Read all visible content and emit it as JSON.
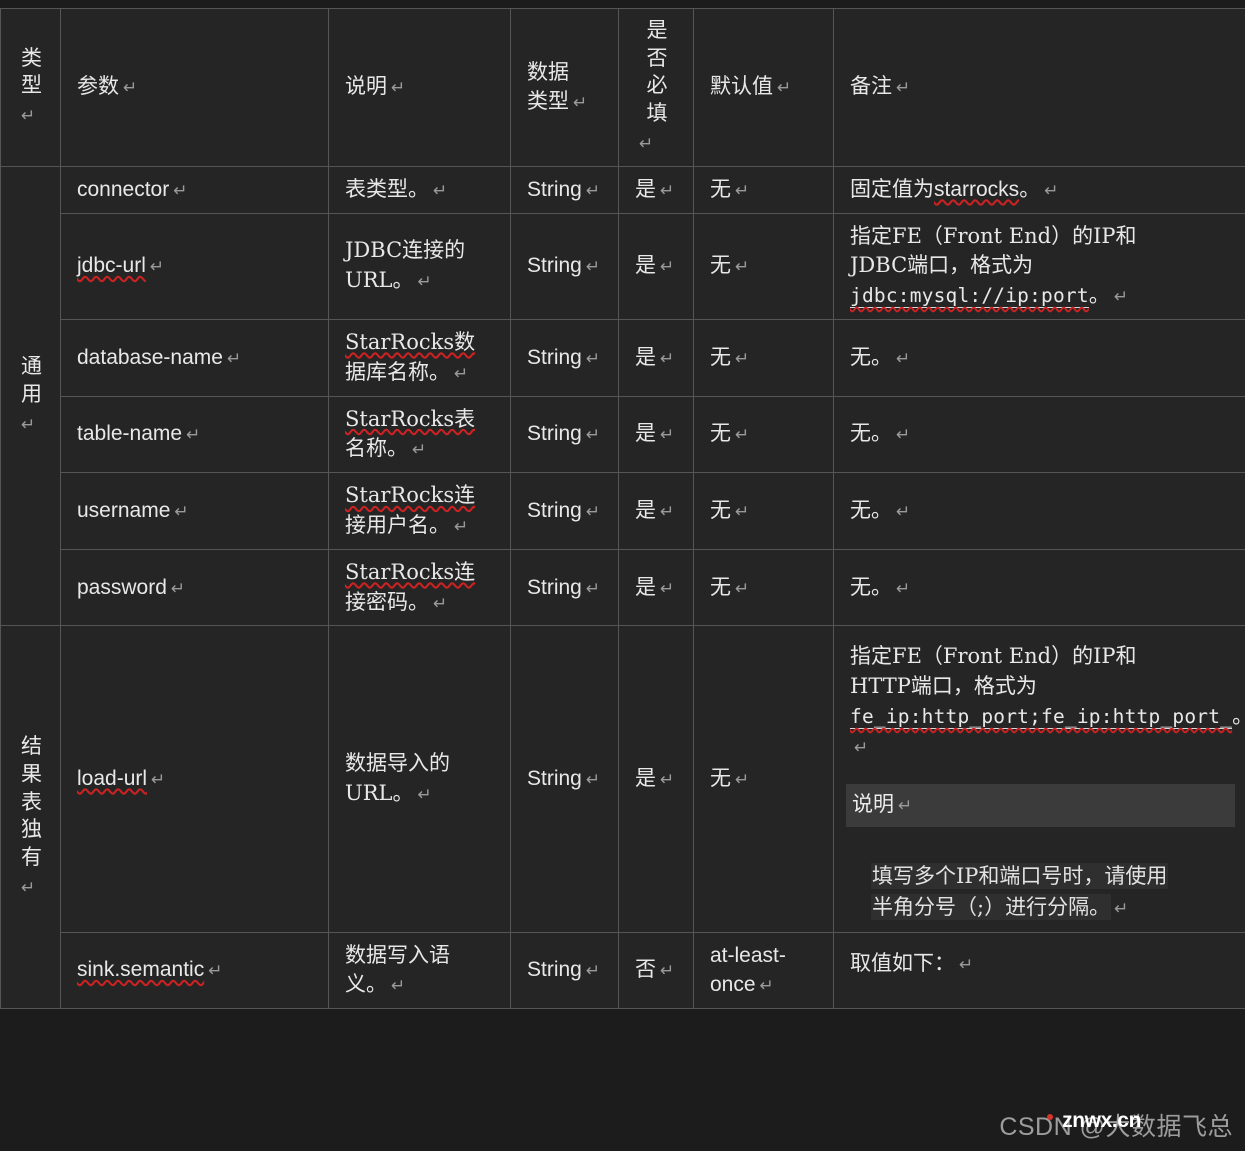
{
  "table": {
    "columns": [
      {
        "key": "type",
        "label": "类型"
      },
      {
        "key": "param",
        "label": "参数"
      },
      {
        "key": "desc",
        "label": "说明"
      },
      {
        "key": "dtype",
        "label": "数据类型"
      },
      {
        "key": "req",
        "label": "是否必填"
      },
      {
        "key": "default",
        "label": "默认值"
      },
      {
        "key": "remark",
        "label": "备注"
      }
    ],
    "groups": [
      {
        "label": "通用",
        "rowspan": 6
      },
      {
        "label": "结果表独有",
        "rowspan": 2
      }
    ],
    "rows": [
      {
        "param": "connector",
        "desc": "表类型。",
        "dtype": "String",
        "req": "是",
        "default": "无",
        "remark_pre": "固定值为",
        "remark_code": "starrocks",
        "remark_post": "。"
      },
      {
        "param": "jdbc-url",
        "desc_line1": "JDBC连接的",
        "desc_line2": "URL。",
        "dtype": "String",
        "req": "是",
        "default": "无",
        "remark_line1": "指定FE（Front End）的IP和",
        "remark_line2": "JDBC端口，格式为",
        "remark_code": "jdbc:mysql://ip:port",
        "remark_tail": "。"
      },
      {
        "param": "database-name",
        "desc_line1": "StarRocks数",
        "desc_line2": "据库名称。",
        "dtype": "String",
        "req": "是",
        "default": "无",
        "remark": "无。"
      },
      {
        "param": "table-name",
        "desc_line1": "StarRocks表",
        "desc_line2": "名称。",
        "dtype": "String",
        "req": "是",
        "default": "无",
        "remark": "无。"
      },
      {
        "param": "username",
        "desc_line1": "StarRocks连",
        "desc_line2": "接用户名。",
        "dtype": "String",
        "req": "是",
        "default": "无",
        "remark": "无。"
      },
      {
        "param": "password",
        "desc_line1": "StarRocks连",
        "desc_line2": "接密码。",
        "dtype": "String",
        "req": "是",
        "default": "无",
        "remark": "无。"
      },
      {
        "param": "load-url",
        "desc_line1": "数据导入的",
        "desc_line2": "URL。",
        "dtype": "String",
        "req": "是",
        "default": "无",
        "remark_line1": "指定FE（Front End）的IP和",
        "remark_line2": "HTTP端口，格式为",
        "remark_code": "fe_ip:http_port;fe_ip:http_port_",
        "remark_tail": "。",
        "note_title": "说明",
        "note_line1": "填写多个IP和端口号时，请使用",
        "note_line2": "半角分号（;）进行分隔。"
      },
      {
        "param": "sink.semantic",
        "desc_line1": "数据写入语",
        "desc_line2": "义。",
        "dtype": "String",
        "req": "否",
        "default_line1": "at-least-",
        "default_line2": "once",
        "remark": "取值如下："
      }
    ]
  },
  "marks": {
    "pilcrow": "↵"
  },
  "watermark": {
    "text": "CSDN @大数据飞总",
    "logo": "znwx.cn"
  },
  "colors": {
    "header_bg": "#424242",
    "cell_bg": "#252525",
    "border": "#555555",
    "text": "#e8e8e8",
    "spellcheck": "#cc2222",
    "note_bar_bg": "#3b3b3b",
    "page_bg": "#1c1c1c"
  }
}
